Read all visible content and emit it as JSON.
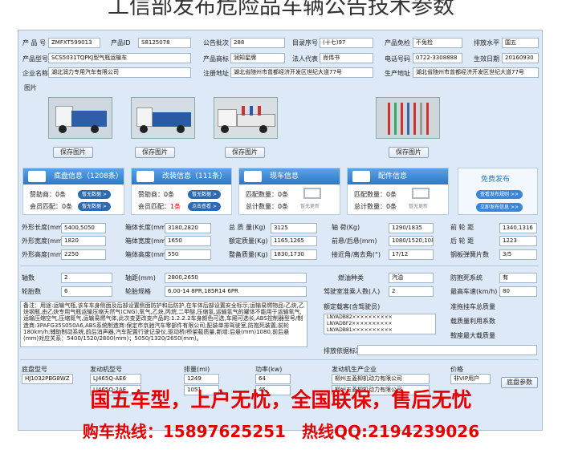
{
  "title": "工信部发布危险品车辆公告技术参数",
  "row1": {
    "l1": "产 品 号",
    "v1": "ZMFXT599013",
    "l2": "产品ID",
    "v2": "S8125078",
    "l3": "公告批次",
    "v3": "288",
    "l4": "目录序号",
    "v4": "(十七)97",
    "l5": "产品免检",
    "v5": "不免检",
    "l6": "排放水平",
    "v6": "国五"
  },
  "row2": {
    "l1": "产品型号",
    "v1": "SCS5031TQPKJ型气瓶运输车",
    "l2": "产品商标",
    "v2": "润知星牌",
    "l3": "法人代表",
    "v3": "肖伟书",
    "l4": "电话号码",
    "v4": "0722-3308888",
    "l5": "生效日期",
    "v5": "20160930"
  },
  "row3": {
    "l1": "企业名称",
    "v1": "湖北润力专用汽车有限公司",
    "l2": "注册地址",
    "v2": "湖北省随州市曾都经济开发区世纪大道77号",
    "l3": "生产地址",
    "v3": "湖北省随州市曾都经济开发区世纪大道77号"
  },
  "photos": {
    "label": "图片",
    "save": "保存图片"
  },
  "cards": {
    "chassis": {
      "title": "底盘信息（1208条）",
      "r1": "赞助商：0条",
      "r2": "会员匹配：0条",
      "b1": "暂无数据 >",
      "b2": "暂无数据 >"
    },
    "modify": {
      "title": "改装信息（111条）",
      "r1": "赞助商：0条",
      "r2a": "会员匹配：",
      "r2b": "1条",
      "b1": "暂无数据 >",
      "b2": "点击查看 >"
    },
    "car": {
      "title": "现车信息",
      "r1": "匹配数量：0条",
      "r2": "总计数量：0条",
      "empty": "暂无更新"
    },
    "parts": {
      "title": "配件信息",
      "r1": "匹配数量：0条",
      "r2": "总计数量：0条",
      "empty": "暂无更新"
    },
    "free": {
      "title": "免费发布",
      "b1": "查看发布规则 >>",
      "b2": "立即发布信息 >>"
    }
  },
  "specs": {
    "a1": "外形长度(mm)",
    "av1": "5400,5050",
    "a2": "外形宽度(mm)",
    "av2": "1820",
    "a3": "外形高度(mm)",
    "av3": "2250",
    "b1": "箱体长度(mm)",
    "bv1": "3180,2820",
    "b2": "箱体宽度(mm)",
    "bv2": "1650",
    "b3": "箱体高度(mm)",
    "bv3": "550",
    "c1": "总 质 量(Kg)",
    "cv1": "3125",
    "c2": "额定质量(Kg)",
    "cv2": "1165,1265",
    "c3": "整备质量(Kg)",
    "cv3": "1830,1730",
    "d1": "轴 荷(Kg)",
    "dv1": "1290/1835",
    "d2": "前悬/后悬(mm)",
    "dv2": "1080/1520,1080",
    "d3": "接近角/离去角(°)",
    "dv3": "17/12",
    "e1": "前 轮 距",
    "ev1": "1340,1316",
    "e2": "后 轮 距",
    "ev2": "1223",
    "e3": "钢板弹簧片数",
    "ev3": "3/5"
  },
  "axle": {
    "l1": "轴数",
    "v1": "2",
    "l2": "轴距(mm)",
    "v2": "2800,2650",
    "l3": "轮胎数",
    "v3": "6",
    "l4": "轮胎规格",
    "v4": "6.00-14 8PR,185R14 6PR"
  },
  "fuel": {
    "l1": "燃油种类",
    "v1": "汽油",
    "l2": "防抱死系统",
    "v2": "有",
    "l3": "驾驶室准乘人数(人)",
    "v3": "2",
    "l4": "最高车速(km/h)",
    "v4": "80",
    "l5": "额定载客(含驾驶员)",
    "l6": "准拖挂车总质量",
    "l7": "载质量利用系数",
    "l8": "鞍座最大载质量",
    "l9": "排放依据标准",
    "vin": "LNYADB82××××××××××\nLNYADBF2××××××××××\nLNYADB81××××××××××"
  },
  "notes": "备注：用途:运输气瓶,该车车身侧面及后部设置侧面防护和后防护,在车体后部设置安全标示;运输易燃物品:乙炔,乙炔钢瓶,由乙炔专用气瓶运输压缩天然气(CNG),氧气,乙炔,丙烷,二甲醚,压缩氢,运输氢气的罐体不能用于运输氧气,运输压缩空气,压缩氮气,运输易燃气体,此次变更改变产品的:1.2.2.2车身颜色可选,车厢可选长,ABS控制器型号/制造商:3PAFG35S050A6,ABS系统制造商:保定市京驰汽车零部件有限公司;配装单排驾驶室,防抱死装置,前轮180km/h;辅助制动系统,前后消声器,汽车配置行驶记录仪,驱动桥/桥架载质量,新增:后悬(mm)1080,前后悬(mm)对应关系：5400/1520/2800(mm)；5050/1320/2650(mm)。",
  "engine": {
    "l1": "底盘型号",
    "v1": "HJ1032PBG8WZ",
    "l2": "发动机型号",
    "v2a": "LJ465Q-AE6",
    "v2b": "LJ465Q-2AE",
    "l3": "排量(ml)",
    "v3a": "1249",
    "v3b": "1051",
    "l4": "功率(kw)",
    "v4a": "64",
    "v4b": "45",
    "l5": "发动机生产企业",
    "v5a": "柳州五菱柳机动力有限公司",
    "v5b": "柳州五菱柳机动力有限公司",
    "l6": "价格",
    "v6": "非VIP用户",
    "btn": "底盘参数"
  },
  "promo1": "国五车型，上户无忧，全国联保，售后无忧",
  "promo2": "购车热线：15897625251　热线QQ:2194239026"
}
